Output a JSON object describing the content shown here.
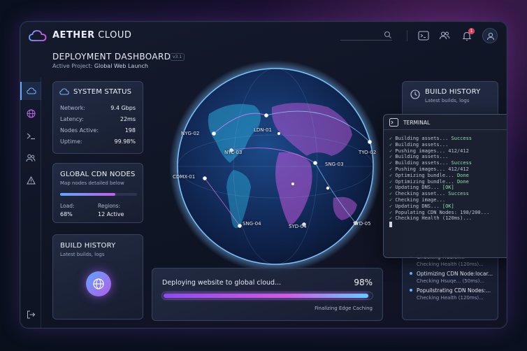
{
  "app": {
    "name_bold": "AETHER",
    "name_light": "CLOUD"
  },
  "header": {
    "notification_count": "1"
  },
  "page": {
    "title": "DEPLOYMENT DASHBOARD",
    "version": "v3.1",
    "project_label": "Active Project:",
    "project_name": "Global Web Launch"
  },
  "system_status": {
    "title": "SYSTEM STATUS",
    "stats": [
      {
        "label": "Network:",
        "value": "9.4 Gbps"
      },
      {
        "label": "Latency:",
        "value": "22ms"
      },
      {
        "label": "Nodes Active:",
        "value": "198"
      },
      {
        "label": "Uptime:",
        "value": "99.98%"
      }
    ]
  },
  "cdn": {
    "title": "GLOBAL CDN NODES",
    "subtitle": "Map nodes detailed below",
    "progress": 0.72,
    "load_label": "Load:",
    "load_value": "68%",
    "regions_label": "Regions:",
    "regions_value": "12 Active"
  },
  "build_history_left": {
    "title": "BUILD HISTORY",
    "subtitle": "Latest builds, logs"
  },
  "globe": {
    "cities": [
      "NYG-02",
      "LDN-01",
      "NYC-03",
      "TYO-02",
      "SNG-03",
      "CDMX-01",
      "SNG-04",
      "SYD-04",
      "SYD-05"
    ]
  },
  "deploy": {
    "text": "Deploying website to global cloud...",
    "percent_label": "98%",
    "progress": 0.98,
    "status": "Finalizing Edge Caching"
  },
  "build_history": {
    "title": "BUILD HISTORY",
    "subtitle": "Latest builds, logs",
    "items": [
      {
        "title": "Checking Health...",
        "sub": "Checking Health (120ms)..."
      },
      {
        "title": "Optimizing CDN Node:locar...",
        "sub": "Checking Hsuqe... (50ms)..."
      },
      {
        "title": "Popuilstrating CDN Nodes:...",
        "sub": "Checking Health (120ms)..."
      }
    ]
  },
  "terminal": {
    "title": "TERMINAL",
    "lines": [
      "✓ Building assets... Success",
      "✓ Building assets...",
      "✓ Pushing images... 412/412",
      "✓ Building assets...",
      "✓ Building assets... Success",
      "✓ Pushing images... 412/412",
      "✓ Optimizing bundle... Done",
      "✓ Optimizing bundle... Done",
      "✓ Updating DNS... [OK]",
      "✓ Checking asset... Success",
      "✓ Checking image...",
      "✓ Updating DNS... [OK]",
      "✓ Populating CDN Nodes: 198/200...",
      "✓ Checking Health (120ms)..."
    ]
  },
  "colors": {
    "accent": "#6aa6ff",
    "magenta": "#d05ae0",
    "violet": "#8a4cf0",
    "ok": "#5cd38a"
  }
}
